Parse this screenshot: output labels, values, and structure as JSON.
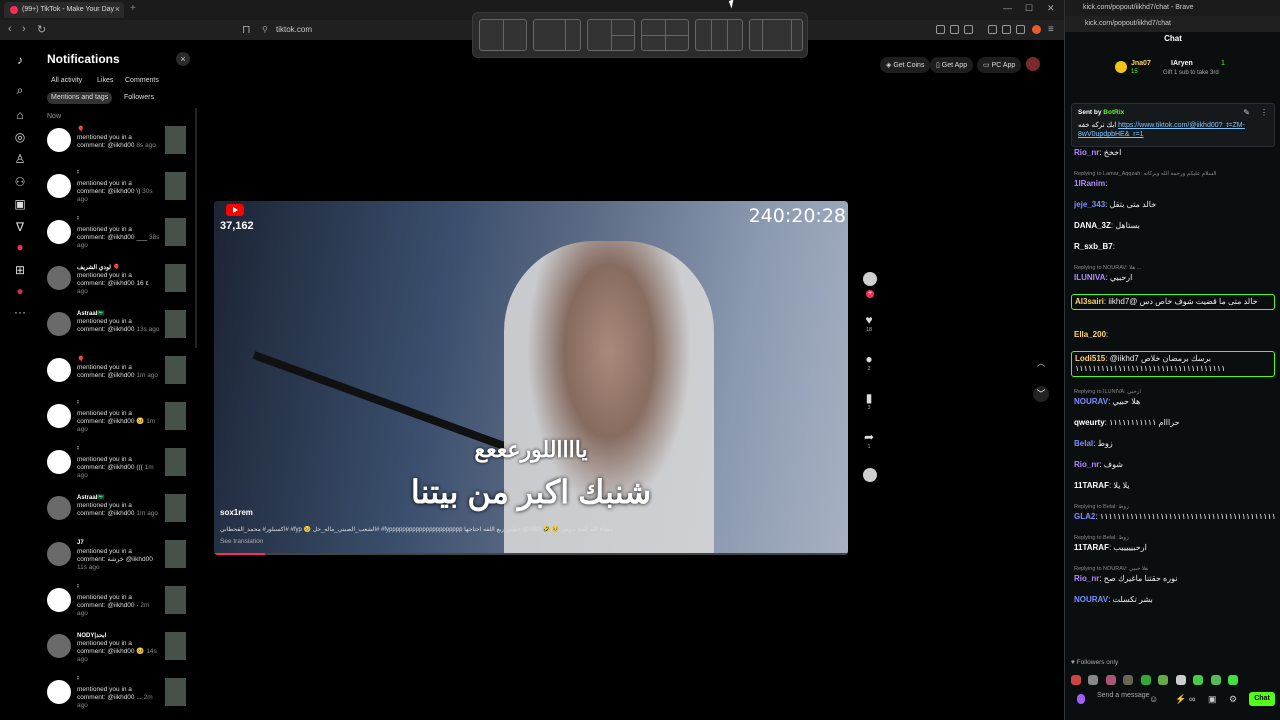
{
  "left_window": {
    "tab_title": "(99+) TikTok - Make Your Day",
    "url": "tiktok.com",
    "new_tab": "+",
    "tab_close": "×",
    "win_controls": [
      "—",
      "☐",
      "✕"
    ]
  },
  "notifications": {
    "title": "Notifications",
    "close": "×",
    "filters_row1": [
      "All activity",
      "Likes",
      "Comments"
    ],
    "filters_row2": [
      "Mentions and tags",
      "Followers"
    ],
    "section_now": "Now",
    "items": [
      {
        "name": "🎈",
        "text": "mentioned you in a comment: @iikhd00",
        "time": "8s ago"
      },
      {
        "name": "ꜞ",
        "text": "mentioned you in a comment: @iikhd00 \\)",
        "time": "30s ago"
      },
      {
        "name": "ꜞ",
        "text": "mentioned you in a comment: @iikhd00 ___",
        "time": "38s ago"
      },
      {
        "name": "لودي الشريف 🎈",
        "text": "mentioned you in a comment: @iikhd00 16 ٤",
        "time": "ago"
      },
      {
        "name": "Astraal🇸🇦",
        "text": "mentioned you in a comment: @iikhd00",
        "time": "13s ago"
      },
      {
        "name": "🎈",
        "text": "mentioned you in a comment: @iikhd00",
        "time": "1m ago"
      },
      {
        "name": "ꜞ",
        "text": "mentioned you in a comment: @iikhd00 🥺",
        "time": "1m ago"
      },
      {
        "name": "ꜞ",
        "text": "mentioned you in a comment: @iikhd00 (((",
        "time": "1m ago"
      },
      {
        "name": "Astraal🇸🇦",
        "text": "mentioned you in a comment: @iikhd00",
        "time": "1m ago"
      },
      {
        "name": "J7",
        "text": "mentioned you in a comment: خرشة @iikhd00",
        "time": "11s ago"
      },
      {
        "name": "ꜞ",
        "text": "mentioned you in a comment: @iikhd00 ·",
        "time": "2m ago"
      },
      {
        "name": "NODY|ابحد",
        "text": "mentioned you in a comment: @iikhd00 🥺",
        "time": "14s ago"
      },
      {
        "name": "ꜞ",
        "text": "mentioned you in a comment: @iikhd00 ...",
        "time": "2m ago"
      }
    ]
  },
  "top_actions": {
    "get_coins": "Get Coins",
    "get_app": "Get App",
    "pc_app": "PC App"
  },
  "video": {
    "viewers": "37,162",
    "timer": "240:20:28",
    "subtitle_line1": "يااااللورعععع",
    "subtitle_line2": "شنبك اكبر من بيتنا",
    "username": "sox1rem",
    "caption": "اكسبلور# محمد_القحطاني# #fyp 🥺 الشعب_الصيني_ماله_حل# #fypppppppppppppppppppppp عطني ربع اللقه احتاجها @ABS 🤣 🥺 مشاء الله لفته ندوس",
    "see_translation": "See translation",
    "progress_fraction": 0.08
  },
  "side_actions": {
    "likes": "18",
    "comments": "2",
    "saves": "3",
    "shares": "1"
  },
  "right_window": {
    "url": "kick.com/popout/iikhd7/chat - Brave",
    "address": "kick.com/popout/iikhd7/chat",
    "chat_title": "Chat",
    "gift_user1": "Jna07",
    "gift_count1": "15",
    "gift_user2": "IAryen",
    "gift_count2": "1",
    "gift_sub_text": "Gift 1 sub to take 3rd",
    "pinned_sent_by": "Sent by",
    "pinned_bot": "BotRix",
    "pinned_text": "ابك تركه خفه",
    "pinned_link": "https://www.tiktok.com/@iikhd00?_t=ZM-8wV0updpbHE&_r=1",
    "followers_only": "Followers only",
    "send_placeholder": "Send a message",
    "chat_button": "Chat",
    "messages": [
      {
        "type": "msg",
        "user": "Rio_nr",
        "color": "#b388ff",
        "text": "اخخخ"
      },
      {
        "type": "reply",
        "text": "Replying to Lamar_Aqqzah: السلام عليكم ورحمة الله وبركاته"
      },
      {
        "type": "msg",
        "user": "1lRanim",
        "color": "#b388ff",
        "text": ""
      },
      {
        "type": "msg",
        "user": "jeje_343",
        "color": "#7c8cff",
        "text": "خالد متى بتقل"
      },
      {
        "type": "msg",
        "user": "DANA_3Z",
        "color": "#ffffff",
        "text": "بستاهل"
      },
      {
        "type": "msg",
        "user": "R_sxb_B7",
        "color": "#ffffff",
        "text": ""
      },
      {
        "type": "reply",
        "text": "Replying to NOURAV: هلا ..."
      },
      {
        "type": "msg",
        "user": "ILUNIVA",
        "color": "#b388ff",
        "text": "ارحبيي"
      },
      {
        "type": "boxed",
        "user": "Al3sairi",
        "color": "#ffd36b",
        "text": "خالد متى ما قضيت شوف خاص دس @iikhd7"
      },
      {
        "type": "msg",
        "user": "Ella_200",
        "color": "#ffd36b",
        "text": ""
      },
      {
        "type": "boxed",
        "user": "Lodi515",
        "color": "#ffd36b",
        "text": "@iikhd7 برسك برمضان خلاص ١١١١١١١١١١١١١١١١١١١١١١١١١١١١١١١١١١١"
      },
      {
        "type": "reply",
        "text": "Replying to ILUNIVA: ارحبي"
      },
      {
        "type": "msg",
        "user": "NOURAV",
        "color": "#7c8cff",
        "text": "هلا حبيي"
      },
      {
        "type": "msg",
        "user": "qweurty",
        "color": "#ffffff",
        "text": "حرااام ١١١١١١١١١١١"
      },
      {
        "type": "msg",
        "user": "Belal",
        "color": "#7c8cff",
        "text": "زوط"
      },
      {
        "type": "msg",
        "user": "Rio_nr",
        "color": "#b388ff",
        "text": "شوف"
      },
      {
        "type": "msg",
        "user": "11TARAF",
        "color": "#ffffff",
        "text": "يلا يلا"
      },
      {
        "type": "reply",
        "text": "Replying to Belal: زوط"
      },
      {
        "type": "msg",
        "user": "GLA2",
        "color": "#7c8cff",
        "text": "١١١١١١١١١١١١١١١١١١١١١١١١١١١١١١١١١١١١١١١١١١١١١١١١١١١١١١١١١١١١١"
      },
      {
        "type": "reply",
        "text": "Replying to Belal: زوط"
      },
      {
        "type": "msg",
        "user": "11TARAF",
        "color": "#ffffff",
        "text": "ارحبيييييب"
      },
      {
        "type": "reply",
        "text": "Replying to NOURAV: هلا حبيي"
      },
      {
        "type": "msg",
        "user": "Rio_nr",
        "color": "#b388ff",
        "text": "نوره حقتنا ماغيرك صح"
      },
      {
        "type": "msg",
        "user": "NOURAV",
        "color": "#7c8cff",
        "text": "بشر تكسلت"
      }
    ]
  },
  "colors": {
    "tiktok_accent": "#fe2c55",
    "kick_accent": "#53fc18"
  }
}
